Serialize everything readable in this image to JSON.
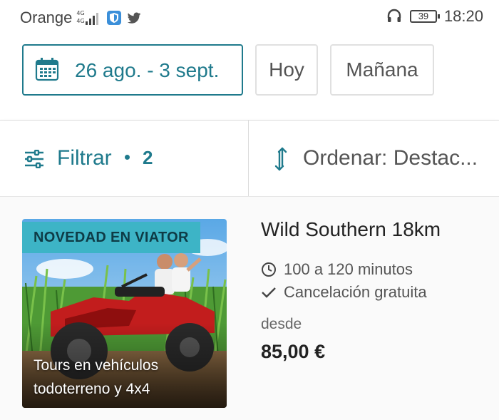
{
  "status_bar": {
    "carrier": "Orange",
    "network_top": "4G",
    "network_bottom": "4G",
    "battery": "39",
    "time": "18:20",
    "icons": [
      "shield-icon",
      "twitter-bird-icon",
      "headset-icon",
      "battery-icon",
      "signal-icon"
    ]
  },
  "dates": {
    "range_label": "26 ago. - 3 sept.",
    "today_label": "Hoy",
    "tomorrow_label": "Mañana"
  },
  "toolbar": {
    "filter_label": "Filtrar",
    "filter_count": "2",
    "sort_label": "Ordenar: Destac..."
  },
  "results": [
    {
      "badge": "NOVEDAD EN VIATOR",
      "image_caption": "Tours en vehículos todoterreno y 4x4",
      "title": "Wild Southern 18km",
      "duration": "100 a 120 minutos",
      "cancellation": "Cancelación gratuita",
      "price_prefix": "desde",
      "price": "85,00 €"
    }
  ],
  "colors": {
    "accent": "#1f7a8c",
    "badge_bg": "#3db4c6",
    "border": "#e0e0e0"
  }
}
